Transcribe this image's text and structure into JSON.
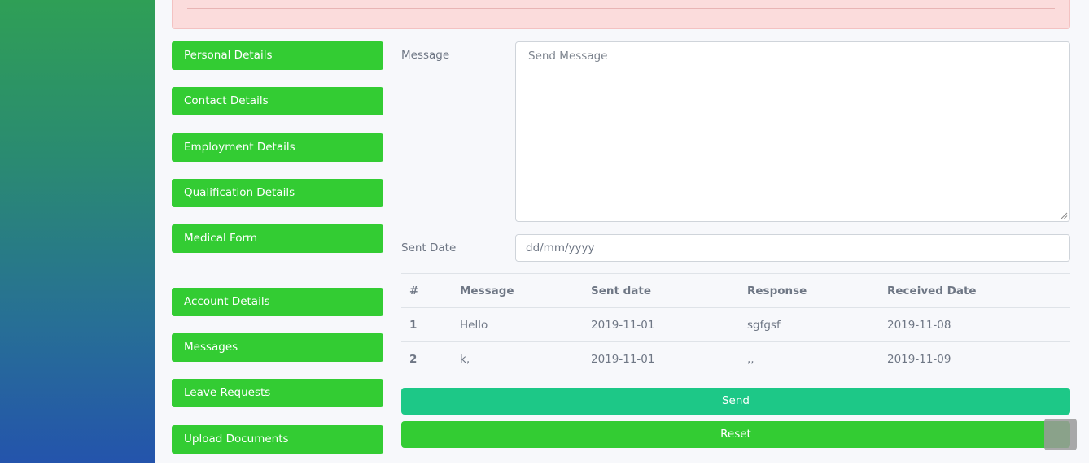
{
  "sidebar": {
    "items": [
      {
        "label": "Personal Details"
      },
      {
        "label": "Contact Details"
      },
      {
        "label": "Employment Details"
      },
      {
        "label": "Qualification Details"
      },
      {
        "label": "Medical Form"
      },
      {
        "label": "Account Details"
      },
      {
        "label": "Messages"
      },
      {
        "label": "Leave Requests"
      },
      {
        "label": "Upload Documents"
      }
    ]
  },
  "form": {
    "message_label": "Message",
    "message_placeholder": "Send Message",
    "sent_date_label": "Sent Date",
    "sent_date_placeholder": "dd/mm/yyyy"
  },
  "table": {
    "headers": [
      "#",
      "Message",
      "Sent date",
      "Response",
      "Received Date"
    ],
    "rows": [
      {
        "index": "1",
        "message": "Hello",
        "sent_date": "2019-11-01",
        "response": "sgfgsf",
        "received_date": "2019-11-08"
      },
      {
        "index": "2",
        "message": "k,",
        "sent_date": "2019-11-01",
        "response": ",,",
        "received_date": "2019-11-09"
      }
    ]
  },
  "actions": {
    "send_label": "Send",
    "reset_label": "Reset"
  },
  "colors": {
    "nav_button": "#33cc33",
    "send_button": "#1dc887",
    "alert_background": "#fbdcdc"
  },
  "icons": {
    "scroll_top": "scroll-to-top-icon",
    "resize": "resize-grip-icon"
  }
}
